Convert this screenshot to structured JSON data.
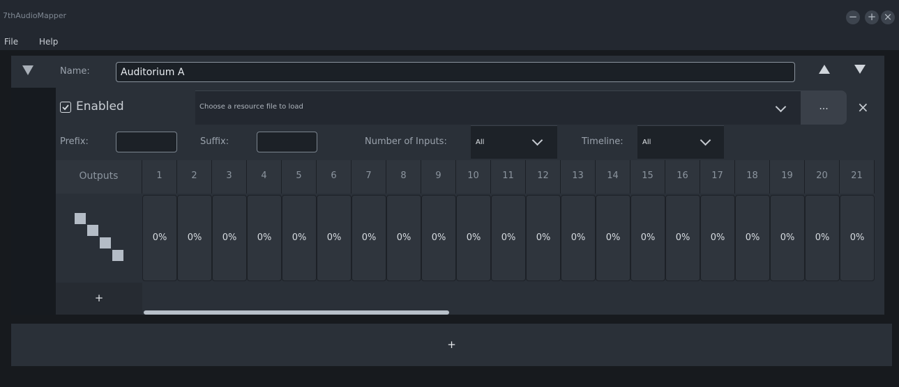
{
  "app": {
    "title": "7thAudioMapper"
  },
  "window_controls": {
    "minimize": "−",
    "maximize": "+",
    "close": "×"
  },
  "menu": {
    "items": [
      "File",
      "Help"
    ]
  },
  "mapper": {
    "name_label": "Name:",
    "name_value": "Auditorium A",
    "enabled_label": "Enabled",
    "enabled": true,
    "resource_placeholder": "Choose a resource file to load",
    "browse_label": "...",
    "clear_label": "×",
    "prefix_label": "Prefix:",
    "suffix_label": "Suffix:",
    "inputs_label": "Number of Inputs:",
    "inputs_value": "All",
    "timeline_label": "Timeline:",
    "timeline_value": "All",
    "outputs_header": "Outputs",
    "add_output_label": "+",
    "columns": [
      "1",
      "2",
      "3",
      "4",
      "5",
      "6",
      "7",
      "8",
      "9",
      "10",
      "11",
      "12",
      "13",
      "14",
      "15",
      "16",
      "17",
      "18",
      "19",
      "20",
      "21"
    ],
    "values": [
      "0%",
      "0%",
      "0%",
      "0%",
      "0%",
      "0%",
      "0%",
      "0%",
      "0%",
      "0%",
      "0%",
      "0%",
      "0%",
      "0%",
      "0%",
      "0%",
      "0%",
      "0%",
      "0%",
      "0%",
      "0%"
    ]
  },
  "add_mapper_label": "+"
}
